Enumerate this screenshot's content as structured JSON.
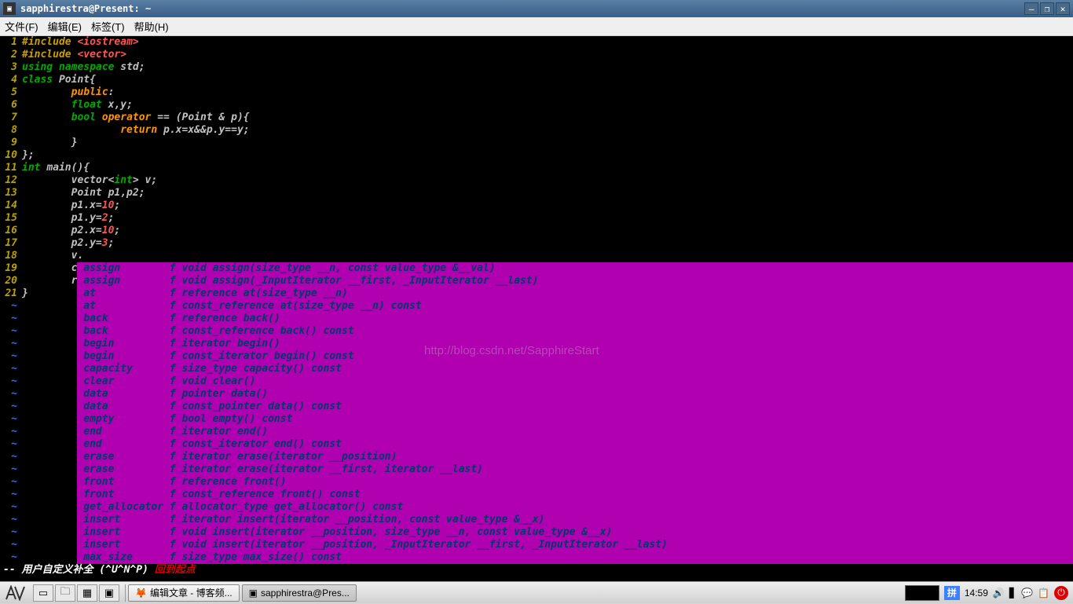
{
  "window": {
    "title": "sapphirestra@Present: ~"
  },
  "menubar": {
    "file": "文件(F)",
    "edit": "编辑(E)",
    "tabs": "标签(T)",
    "help": "帮助(H)"
  },
  "source_lines": [
    {
      "n": 1,
      "tokens": [
        [
          "k-preproc",
          "#include "
        ],
        [
          "k-include",
          "<iostream>"
        ]
      ]
    },
    {
      "n": 2,
      "tokens": [
        [
          "k-preproc",
          "#include "
        ],
        [
          "k-include",
          "<vector>"
        ]
      ]
    },
    {
      "n": 3,
      "tokens": [
        [
          "k-using",
          "using "
        ],
        [
          "k-keyword",
          "namespace "
        ],
        [
          "k-ident",
          "std;"
        ]
      ]
    },
    {
      "n": 4,
      "tokens": [
        [
          "k-keyword",
          "class "
        ],
        [
          "k-ident",
          "Point{"
        ]
      ]
    },
    {
      "n": 5,
      "tokens": [
        [
          "k-ident",
          "        "
        ],
        [
          "k-special",
          "public"
        ],
        [
          "k-ident",
          ":"
        ]
      ]
    },
    {
      "n": 6,
      "tokens": [
        [
          "k-ident",
          "        "
        ],
        [
          "k-type",
          "float "
        ],
        [
          "k-ident",
          "x,y;"
        ]
      ]
    },
    {
      "n": 7,
      "tokens": [
        [
          "k-ident",
          "        "
        ],
        [
          "k-type",
          "bool "
        ],
        [
          "k-special",
          "operator"
        ],
        [
          "k-ident",
          " == (Point & p){"
        ]
      ]
    },
    {
      "n": 8,
      "tokens": [
        [
          "k-ident",
          "                "
        ],
        [
          "k-special",
          "return"
        ],
        [
          "k-ident",
          " p.x=x&&p.y==y;"
        ]
      ]
    },
    {
      "n": 9,
      "tokens": [
        [
          "k-ident",
          "        }"
        ]
      ]
    },
    {
      "n": 10,
      "tokens": [
        [
          "k-ident",
          "};"
        ]
      ]
    },
    {
      "n": 11,
      "tokens": [
        [
          "k-type",
          "int "
        ],
        [
          "k-ident",
          "main(){"
        ]
      ]
    },
    {
      "n": 12,
      "tokens": [
        [
          "k-ident",
          "        vector<"
        ],
        [
          "k-type",
          "int"
        ],
        [
          "k-ident",
          "> v;"
        ]
      ]
    },
    {
      "n": 13,
      "tokens": [
        [
          "k-ident",
          "        Point p1,p2;"
        ]
      ]
    },
    {
      "n": 14,
      "tokens": [
        [
          "k-ident",
          "        p1.x="
        ],
        [
          "k-number",
          "10"
        ],
        [
          "k-ident",
          ";"
        ]
      ]
    },
    {
      "n": 15,
      "tokens": [
        [
          "k-ident",
          "        p1.y="
        ],
        [
          "k-number",
          "2"
        ],
        [
          "k-ident",
          ";"
        ]
      ]
    },
    {
      "n": 16,
      "tokens": [
        [
          "k-ident",
          "        p2.x="
        ],
        [
          "k-number",
          "10"
        ],
        [
          "k-ident",
          ";"
        ]
      ]
    },
    {
      "n": 17,
      "tokens": [
        [
          "k-ident",
          "        p2.y="
        ],
        [
          "k-number",
          "3"
        ],
        [
          "k-ident",
          ";"
        ]
      ]
    },
    {
      "n": 18,
      "tokens": [
        [
          "k-ident",
          "        v."
        ]
      ]
    }
  ],
  "popup_prefix_lines": [
    {
      "n": 19,
      "prefix": "        c"
    },
    {
      "n": 20,
      "prefix": "        r"
    },
    {
      "n": 21,
      "prefix": "}        "
    }
  ],
  "completions": [
    {
      "name": "assign",
      "sig": "f void assign(size_type __n, const value_type &__val)"
    },
    {
      "name": "assign",
      "sig": "f void assign(_InputIterator __first, _InputIterator __last)"
    },
    {
      "name": "at",
      "sig": "f reference at(size_type __n)"
    },
    {
      "name": "at",
      "sig": "f const_reference at(size_type __n) const"
    },
    {
      "name": "back",
      "sig": "f reference back()"
    },
    {
      "name": "back",
      "sig": "f const_reference back() const"
    },
    {
      "name": "begin",
      "sig": "f iterator begin()"
    },
    {
      "name": "begin",
      "sig": "f const_iterator begin() const"
    },
    {
      "name": "capacity",
      "sig": "f size_type capacity() const"
    },
    {
      "name": "clear",
      "sig": "f void clear()"
    },
    {
      "name": "data",
      "sig": "f pointer data()"
    },
    {
      "name": "data",
      "sig": "f const_pointer data() const"
    },
    {
      "name": "empty",
      "sig": "f bool empty() const"
    },
    {
      "name": "end",
      "sig": "f iterator end()"
    },
    {
      "name": "end",
      "sig": "f const_iterator end() const"
    },
    {
      "name": "erase",
      "sig": "f iterator erase(iterator __position)"
    },
    {
      "name": "erase",
      "sig": "f iterator erase(iterator __first, iterator __last)"
    },
    {
      "name": "front",
      "sig": "f reference front()"
    },
    {
      "name": "front",
      "sig": "f const_reference front() const"
    },
    {
      "name": "get_allocator",
      "sig": "f allocator_type get_allocator() const"
    },
    {
      "name": "insert",
      "sig": "f iterator insert(iterator __position, const value_type &__x)"
    },
    {
      "name": "insert",
      "sig": "f void insert(iterator __position, size_type __n, const value_type &__x)"
    },
    {
      "name": "insert",
      "sig": "f void insert(iterator __position, _InputIterator __first, _InputIterator __last)"
    },
    {
      "name": "max_size",
      "sig": "f size_type max_size() const"
    }
  ],
  "status": {
    "prefix": "-- ",
    "mode": "用户自定义补全 (^U^N^P) ",
    "msg": "回到起点"
  },
  "watermark": "http://blog.csdn.net/SapphireStart",
  "taskbar": {
    "buttons": [
      {
        "label": "编辑文章 - 博客频...",
        "icon": "🦊"
      },
      {
        "label": "sapphirestra@Pres...",
        "icon": "▣"
      }
    ],
    "pinyin": "拼",
    "time": "14:59"
  }
}
